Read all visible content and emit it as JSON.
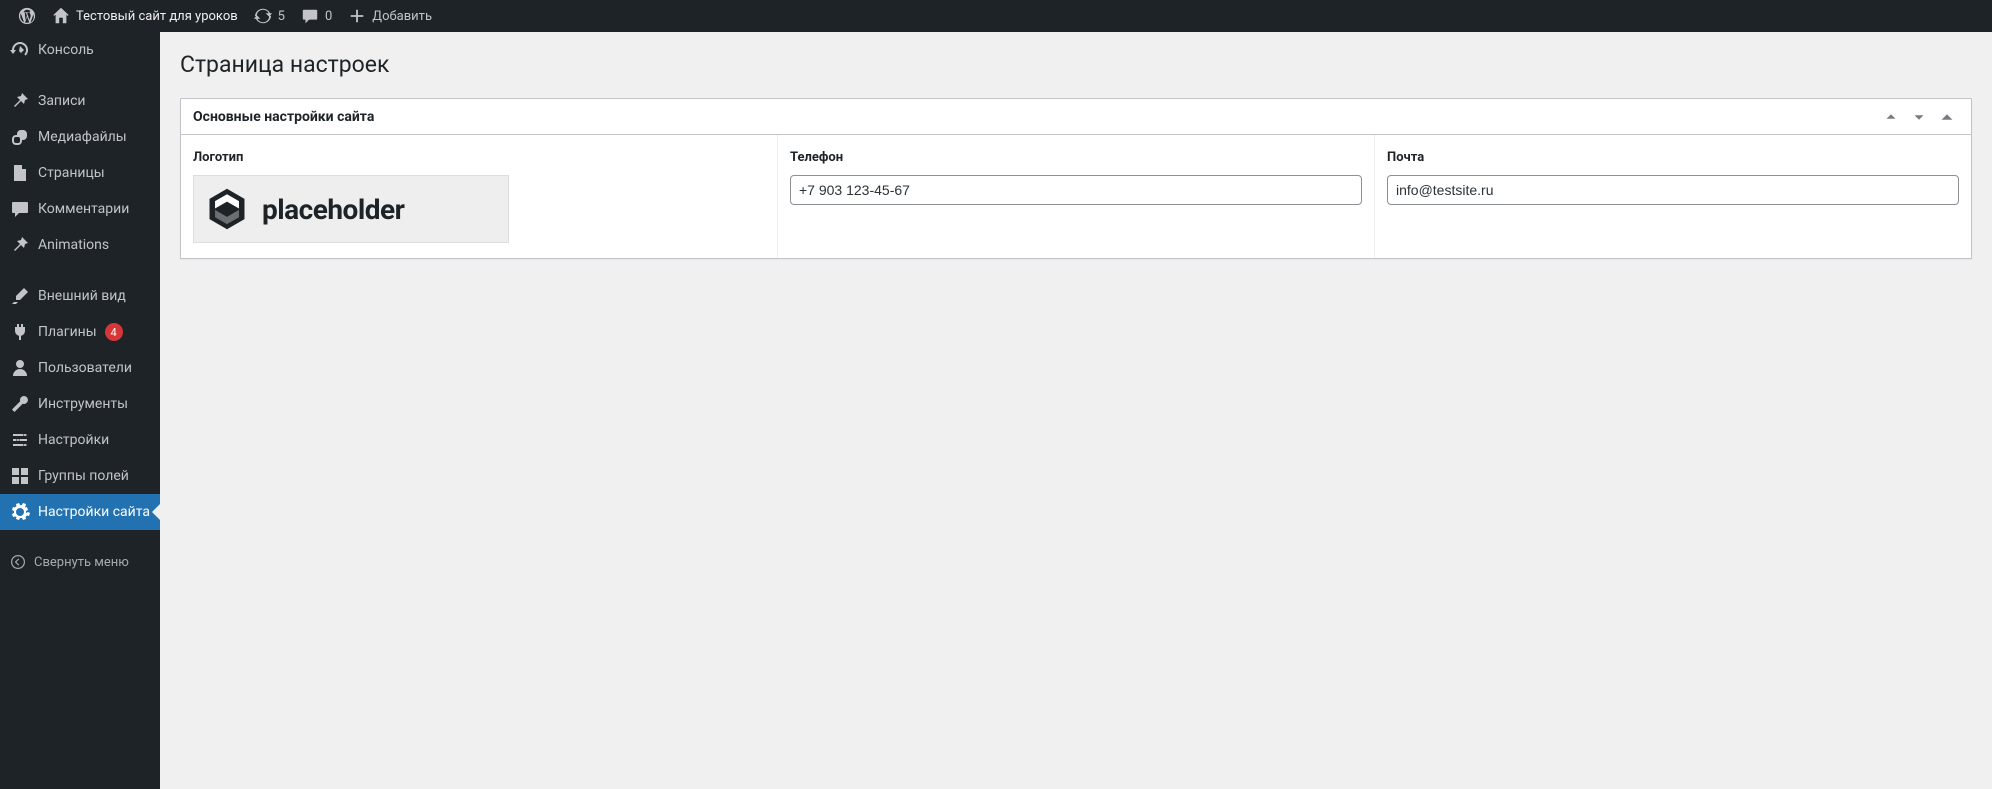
{
  "adminbar": {
    "site_name": "Тестовый сайт для уроков",
    "updates_count": "5",
    "comments_count": "0",
    "add_new": "Добавить"
  },
  "sidebar": {
    "items": [
      {
        "id": "dashboard",
        "label": "Консоль"
      },
      {
        "id": "posts",
        "label": "Записи"
      },
      {
        "id": "media",
        "label": "Медиафайлы"
      },
      {
        "id": "pages",
        "label": "Страницы"
      },
      {
        "id": "comments",
        "label": "Комментарии"
      },
      {
        "id": "animations",
        "label": "Animations"
      },
      {
        "id": "appearance",
        "label": "Внешний вид"
      },
      {
        "id": "plugins",
        "label": "Плагины",
        "badge": "4"
      },
      {
        "id": "users",
        "label": "Пользователи"
      },
      {
        "id": "tools",
        "label": "Инструменты"
      },
      {
        "id": "settings",
        "label": "Настройки"
      },
      {
        "id": "field-groups",
        "label": "Группы полей"
      },
      {
        "id": "site-settings",
        "label": "Настройки сайта",
        "current": true
      }
    ],
    "collapse": "Свернуть меню"
  },
  "page": {
    "title": "Страница настроек",
    "panel_title": "Основные настройки сайта",
    "fields": {
      "logo": {
        "label": "Логотип",
        "placeholder_text": "placeholder"
      },
      "phone": {
        "label": "Телефон",
        "value": "+7 903 123-45-67"
      },
      "email": {
        "label": "Почта",
        "value": "info@testsite.ru"
      }
    }
  }
}
